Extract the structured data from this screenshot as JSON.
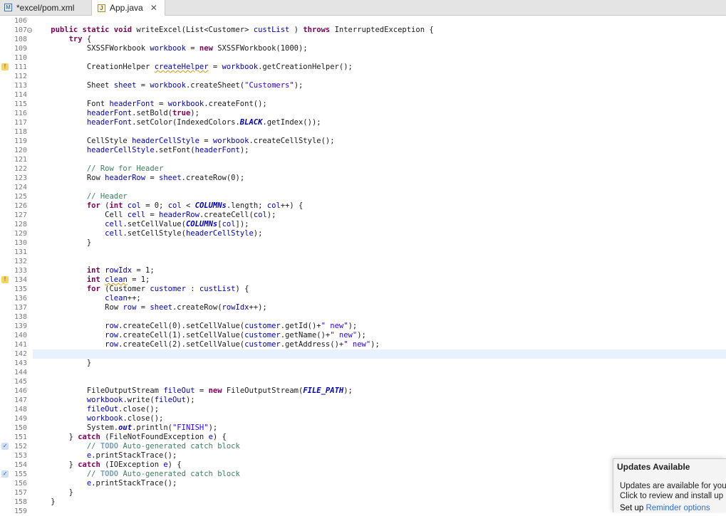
{
  "tabs": [
    {
      "icon": "maven-pom-icon",
      "label": "*excel/pom.xml"
    },
    {
      "icon": "java-file-icon",
      "label": "App.java",
      "close": "✕"
    }
  ],
  "lines": [
    {
      "n": "106",
      "parts": []
    },
    {
      "n": "107",
      "fold": "−",
      "parts": [
        [
          "",
          "    "
        ],
        [
          "kw",
          "public static void "
        ],
        [
          "",
          "writeExcel(List<Customer> "
        ],
        [
          "var",
          "custList"
        ],
        [
          "",
          " ) "
        ],
        [
          "kw",
          "throws "
        ],
        [
          "",
          "InterruptedException {"
        ]
      ]
    },
    {
      "n": "108",
      "parts": [
        [
          "",
          "        "
        ],
        [
          "kw",
          "try "
        ],
        [
          "",
          "{"
        ]
      ]
    },
    {
      "n": "109",
      "parts": [
        [
          "",
          "            SXSSFWorkbook "
        ],
        [
          "var",
          "workbook"
        ],
        [
          "",
          " = "
        ],
        [
          "kw",
          "new "
        ],
        [
          "",
          "SXSSFWorkbook(1000);"
        ]
      ]
    },
    {
      "n": "110",
      "parts": []
    },
    {
      "n": "111",
      "mark": "w",
      "parts": [
        [
          "",
          "            CreationHelper "
        ],
        [
          "varw",
          "createHelper"
        ],
        [
          "",
          " = "
        ],
        [
          "var",
          "workbook"
        ],
        [
          "",
          ".getCreationHelper();"
        ]
      ]
    },
    {
      "n": "112",
      "parts": []
    },
    {
      "n": "113",
      "parts": [
        [
          "",
          "            Sheet "
        ],
        [
          "var",
          "sheet"
        ],
        [
          "",
          " = "
        ],
        [
          "var",
          "workbook"
        ],
        [
          "",
          ".createSheet("
        ],
        [
          "str",
          "\"Customers\""
        ],
        [
          "",
          ");"
        ]
      ]
    },
    {
      "n": "114",
      "parts": []
    },
    {
      "n": "115",
      "parts": [
        [
          "",
          "            Font "
        ],
        [
          "var",
          "headerFont"
        ],
        [
          "",
          " = "
        ],
        [
          "var",
          "workbook"
        ],
        [
          "",
          ".createFont();"
        ]
      ]
    },
    {
      "n": "116",
      "parts": [
        [
          "",
          "            "
        ],
        [
          "var",
          "headerFont"
        ],
        [
          "",
          ".setBold("
        ],
        [
          "kw",
          "true"
        ],
        [
          "",
          ");"
        ]
      ]
    },
    {
      "n": "117",
      "parts": [
        [
          "",
          "            "
        ],
        [
          "var",
          "headerFont"
        ],
        [
          "",
          ".setColor(IndexedColors."
        ],
        [
          "stf",
          "BLACK"
        ],
        [
          "",
          ".getIndex());"
        ]
      ]
    },
    {
      "n": "118",
      "parts": []
    },
    {
      "n": "119",
      "parts": [
        [
          "",
          "            CellStyle "
        ],
        [
          "var",
          "headerCellStyle"
        ],
        [
          "",
          " = "
        ],
        [
          "var",
          "workbook"
        ],
        [
          "",
          ".createCellStyle();"
        ]
      ]
    },
    {
      "n": "120",
      "parts": [
        [
          "",
          "            "
        ],
        [
          "var",
          "headerCellStyle"
        ],
        [
          "",
          ".setFont("
        ],
        [
          "var",
          "headerFont"
        ],
        [
          "",
          ");"
        ]
      ]
    },
    {
      "n": "121",
      "parts": []
    },
    {
      "n": "122",
      "parts": [
        [
          "",
          "            "
        ],
        [
          "cm",
          "// Row for Header"
        ]
      ]
    },
    {
      "n": "123",
      "parts": [
        [
          "",
          "            Row "
        ],
        [
          "var",
          "headerRow"
        ],
        [
          "",
          " = "
        ],
        [
          "var",
          "sheet"
        ],
        [
          "",
          ".createRow(0);"
        ]
      ]
    },
    {
      "n": "124",
      "parts": []
    },
    {
      "n": "125",
      "parts": [
        [
          "",
          "            "
        ],
        [
          "cm",
          "// Header"
        ]
      ]
    },
    {
      "n": "126",
      "parts": [
        [
          "",
          "            "
        ],
        [
          "kw",
          "for "
        ],
        [
          "",
          "("
        ],
        [
          "kw",
          "int "
        ],
        [
          "var",
          "col"
        ],
        [
          "",
          " = 0; "
        ],
        [
          "var",
          "col"
        ],
        [
          "",
          " < "
        ],
        [
          "stf",
          "COLUMNs"
        ],
        [
          "",
          ".length; "
        ],
        [
          "var",
          "col"
        ],
        [
          "",
          "++) {"
        ]
      ]
    },
    {
      "n": "127",
      "parts": [
        [
          "",
          "                Cell "
        ],
        [
          "var",
          "cell"
        ],
        [
          "",
          " = "
        ],
        [
          "var",
          "headerRow"
        ],
        [
          "",
          ".createCell("
        ],
        [
          "var",
          "col"
        ],
        [
          "",
          ");"
        ]
      ]
    },
    {
      "n": "128",
      "parts": [
        [
          "",
          "                "
        ],
        [
          "var",
          "cell"
        ],
        [
          "",
          ".setCellValue("
        ],
        [
          "stf",
          "COLUMNs"
        ],
        [
          "",
          "["
        ],
        [
          "var",
          "col"
        ],
        [
          "",
          "]);"
        ]
      ]
    },
    {
      "n": "129",
      "parts": [
        [
          "",
          "                "
        ],
        [
          "var",
          "cell"
        ],
        [
          "",
          ".setCellStyle("
        ],
        [
          "var",
          "headerCellStyle"
        ],
        [
          "",
          ");"
        ]
      ]
    },
    {
      "n": "130",
      "parts": [
        [
          "",
          "            }"
        ]
      ]
    },
    {
      "n": "131",
      "parts": []
    },
    {
      "n": "132",
      "parts": []
    },
    {
      "n": "133",
      "parts": [
        [
          "",
          "            "
        ],
        [
          "kw",
          "int "
        ],
        [
          "var",
          "rowIdx"
        ],
        [
          "",
          " = 1;"
        ]
      ]
    },
    {
      "n": "134",
      "mark": "w",
      "parts": [
        [
          "",
          "            "
        ],
        [
          "kw",
          "int "
        ],
        [
          "varw",
          "clean"
        ],
        [
          "",
          " = 1;"
        ]
      ]
    },
    {
      "n": "135",
      "parts": [
        [
          "",
          "            "
        ],
        [
          "kw",
          "for "
        ],
        [
          "",
          "(Customer "
        ],
        [
          "var",
          "customer"
        ],
        [
          "",
          " : "
        ],
        [
          "var",
          "custList"
        ],
        [
          "",
          ") {"
        ]
      ]
    },
    {
      "n": "136",
      "parts": [
        [
          "",
          "                "
        ],
        [
          "var",
          "clean"
        ],
        [
          "",
          "++;"
        ]
      ]
    },
    {
      "n": "137",
      "parts": [
        [
          "",
          "                Row "
        ],
        [
          "var",
          "row"
        ],
        [
          "",
          " = "
        ],
        [
          "var",
          "sheet"
        ],
        [
          "",
          ".createRow("
        ],
        [
          "var",
          "rowIdx"
        ],
        [
          "",
          "++);"
        ]
      ]
    },
    {
      "n": "138",
      "parts": []
    },
    {
      "n": "139",
      "parts": [
        [
          "",
          "                "
        ],
        [
          "var",
          "row"
        ],
        [
          "",
          ".createCell(0).setCellValue("
        ],
        [
          "var",
          "customer"
        ],
        [
          "",
          ".getId()+"
        ],
        [
          "str",
          "\" new\""
        ],
        [
          "",
          ");"
        ]
      ]
    },
    {
      "n": "140",
      "parts": [
        [
          "",
          "                "
        ],
        [
          "var",
          "row"
        ],
        [
          "",
          ".createCell(1).setCellValue("
        ],
        [
          "var",
          "customer"
        ],
        [
          "",
          ".getName()+"
        ],
        [
          "str",
          "\" new\""
        ],
        [
          "",
          ");"
        ]
      ]
    },
    {
      "n": "141",
      "parts": [
        [
          "",
          "                "
        ],
        [
          "var",
          "row"
        ],
        [
          "",
          ".createCell(2).setCellValue("
        ],
        [
          "var",
          "customer"
        ],
        [
          "",
          ".getAddress()+"
        ],
        [
          "str",
          "\" new\""
        ],
        [
          "",
          ");"
        ]
      ]
    },
    {
      "n": "142",
      "current": true,
      "parts": []
    },
    {
      "n": "143",
      "parts": [
        [
          "",
          "            }"
        ]
      ]
    },
    {
      "n": "144",
      "parts": []
    },
    {
      "n": "145",
      "parts": []
    },
    {
      "n": "146",
      "parts": [
        [
          "",
          "            FileOutputStream "
        ],
        [
          "var",
          "fileOut"
        ],
        [
          "",
          " = "
        ],
        [
          "kw",
          "new "
        ],
        [
          "",
          "FileOutputStream("
        ],
        [
          "stf",
          "FILE_PATH"
        ],
        [
          "",
          ");"
        ]
      ]
    },
    {
      "n": "147",
      "parts": [
        [
          "",
          "            "
        ],
        [
          "var",
          "workbook"
        ],
        [
          "",
          ".write("
        ],
        [
          "var",
          "fileOut"
        ],
        [
          "",
          ");"
        ]
      ]
    },
    {
      "n": "148",
      "parts": [
        [
          "",
          "            "
        ],
        [
          "var",
          "fileOut"
        ],
        [
          "",
          ".close();"
        ]
      ]
    },
    {
      "n": "149",
      "parts": [
        [
          "",
          "            "
        ],
        [
          "var",
          "workbook"
        ],
        [
          "",
          ".close();"
        ]
      ]
    },
    {
      "n": "150",
      "parts": [
        [
          "",
          "            System."
        ],
        [
          "stf",
          "out"
        ],
        [
          "",
          ".println("
        ],
        [
          "str",
          "\"FINISH\""
        ],
        [
          "",
          ");"
        ]
      ]
    },
    {
      "n": "151",
      "parts": [
        [
          "",
          "        } "
        ],
        [
          "kw",
          "catch "
        ],
        [
          "",
          "(FileNotFoundException "
        ],
        [
          "var",
          "e"
        ],
        [
          "",
          ") {"
        ]
      ]
    },
    {
      "n": "152",
      "mark": "t",
      "parts": [
        [
          "",
          "            "
        ],
        [
          "cm",
          "// "
        ],
        [
          "todo",
          "TODO"
        ],
        [
          "cm",
          " Auto-generated catch block"
        ]
      ]
    },
    {
      "n": "153",
      "parts": [
        [
          "",
          "            "
        ],
        [
          "var",
          "e"
        ],
        [
          "",
          ".printStackTrace();"
        ]
      ]
    },
    {
      "n": "154",
      "parts": [
        [
          "",
          "        } "
        ],
        [
          "kw",
          "catch "
        ],
        [
          "",
          "(IOException "
        ],
        [
          "var",
          "e"
        ],
        [
          "",
          ") {"
        ]
      ]
    },
    {
      "n": "155",
      "mark": "t",
      "parts": [
        [
          "",
          "            "
        ],
        [
          "cm",
          "// "
        ],
        [
          "todo",
          "TODO"
        ],
        [
          "cm",
          " Auto-generated catch block"
        ]
      ]
    },
    {
      "n": "156",
      "parts": [
        [
          "",
          "            "
        ],
        [
          "var",
          "e"
        ],
        [
          "",
          ".printStackTrace();"
        ]
      ]
    },
    {
      "n": "157",
      "parts": [
        [
          "",
          "        }"
        ]
      ]
    },
    {
      "n": "158",
      "parts": [
        [
          "",
          "    }"
        ]
      ]
    },
    {
      "n": "159",
      "parts": []
    }
  ],
  "popup": {
    "title": "Updates Available",
    "line1": "Updates are available for you",
    "line2": "Click to review and install up",
    "setup": "Set up",
    "link": "Reminder options"
  }
}
